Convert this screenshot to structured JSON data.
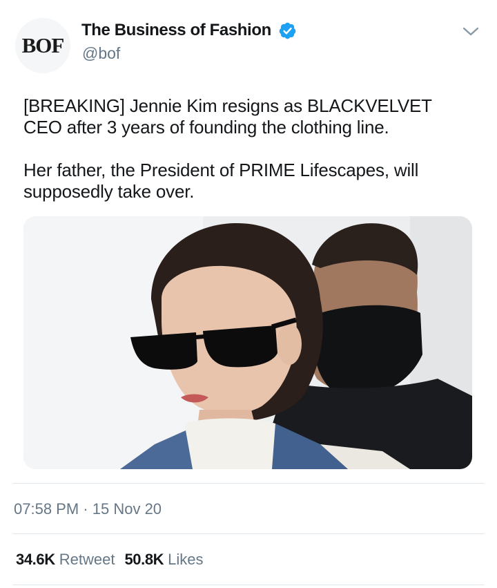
{
  "account": {
    "avatar_text": "BOF",
    "display_name": "The Business of Fashion",
    "handle": "@bof",
    "verified_icon": "verified-badge-icon",
    "menu_icon": "chevron-down-icon"
  },
  "tweet": {
    "paragraphs": [
      "[BREAKING] Jennie Kim resigns as BLACKVELVET CEO after 3 years of founding the clothing line.",
      "Her father, the President of PRIME Lifescapes, will supposedly take over."
    ],
    "time": "07:58 PM",
    "separator": "·",
    "date": "15 Nov 20"
  },
  "stats": {
    "retweets_count": "34.6K",
    "retweets_label": "Retweet",
    "likes_count": "50.8K",
    "likes_label": "Likes"
  },
  "colors": {
    "accent": "#1da1f2",
    "text_primary": "#14171a",
    "text_secondary": "#657786",
    "divider": "#e1e8ed"
  }
}
